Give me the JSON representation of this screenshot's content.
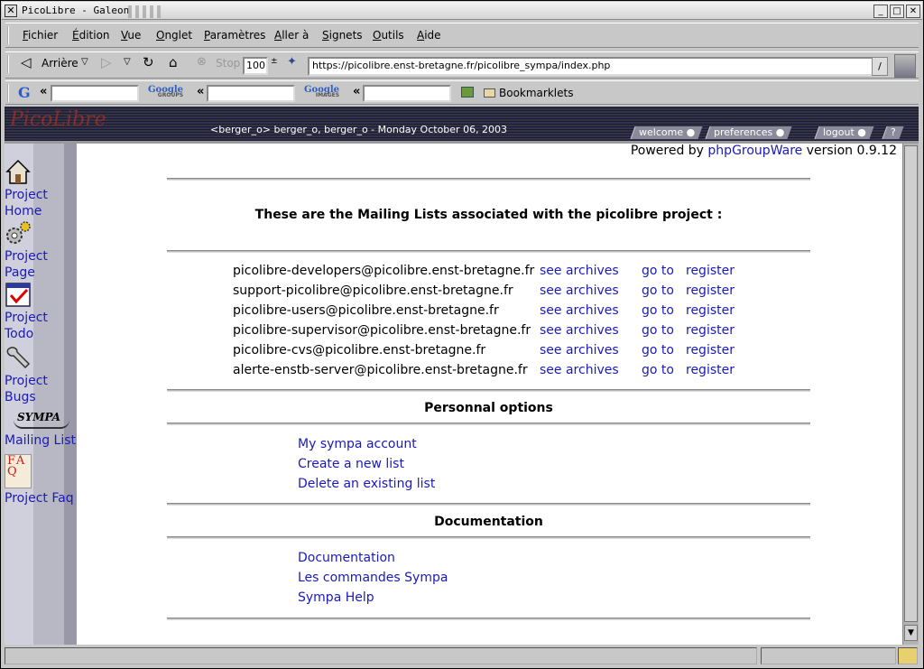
{
  "window": {
    "title": "PicoLibre - Galeon",
    "close_glyph": "✕",
    "min_glyph": "_",
    "max_glyph": "□",
    "x_glyph": "✕"
  },
  "menu": {
    "items": [
      "Fichier",
      "Édition",
      "Vue",
      "Onglet",
      "Paramètres",
      "Aller à",
      "Signets",
      "Outils",
      "Aide"
    ]
  },
  "nav": {
    "back_label": "Arrière",
    "stop_label": "Stop",
    "zoom_value": "100",
    "url": "https://picolibre.enst-bretagne.fr/picolibre_sympa/index.php",
    "dropdown_glyph": "▽",
    "url_button_glyph": "/"
  },
  "search": {
    "google_glyph": "G",
    "laquo": "«",
    "groups_logo": "Google",
    "groups_sub": "GROUPS",
    "images_logo": "Google",
    "images_sub": "IMAGES",
    "bookmarklets_label": "Bookmarklets"
  },
  "banner": {
    "logo": "PicoLibre",
    "userline": "<berger_o> berger_o, berger_o - Monday October 06, 2003",
    "tabs": [
      "welcome ●",
      "preferences ●",
      "logout ●",
      "?"
    ]
  },
  "sidebar": {
    "items": [
      {
        "label": "Project Home",
        "icon": "house-icon"
      },
      {
        "label": "Project Page",
        "icon": "gears-icon"
      },
      {
        "label": "Project Todo",
        "icon": "checklist-icon"
      },
      {
        "label": "Project Bugs",
        "icon": "wrench-icon"
      },
      {
        "label": "Mailing List",
        "icon": "sympa-logo-icon"
      },
      {
        "label": "Project Faq",
        "icon": "faq-icon"
      }
    ],
    "sympa_logo_text": "SYMPA",
    "faq_letters": "FAQ"
  },
  "main": {
    "powered_prefix": "Powered by ",
    "powered_link": "phpGroupWare",
    "powered_suffix": " version 0.9.12",
    "heading": "These are the Mailing Lists associated with the picolibre project :",
    "lists": [
      {
        "name": "picolibre-developers@picolibre.enst-bretagne.fr"
      },
      {
        "name": "support-picolibre@picolibre.enst-bretagne.fr"
      },
      {
        "name": "picolibre-users@picolibre.enst-bretagne.fr"
      },
      {
        "name": "picolibre-supervisor@picolibre.enst-bretagne.fr"
      },
      {
        "name": "picolibre-cvs@picolibre.enst-bretagne.fr"
      },
      {
        "name": "alerte-enstb-server@picolibre.enst-bretagne.fr"
      }
    ],
    "archives_label": "see archives",
    "goto_label": "go to",
    "register_label": "register",
    "personal_heading": "Personnal options",
    "personal_links": [
      "My sympa account",
      "Create a new list",
      "Delete an existing list"
    ],
    "doc_heading": "Documentation",
    "doc_links": [
      "Documentation",
      "Les commandes Sympa",
      "Sympa Help"
    ]
  },
  "colors": {
    "link": "#1a1ab8",
    "banner": "#1a1a3a"
  }
}
